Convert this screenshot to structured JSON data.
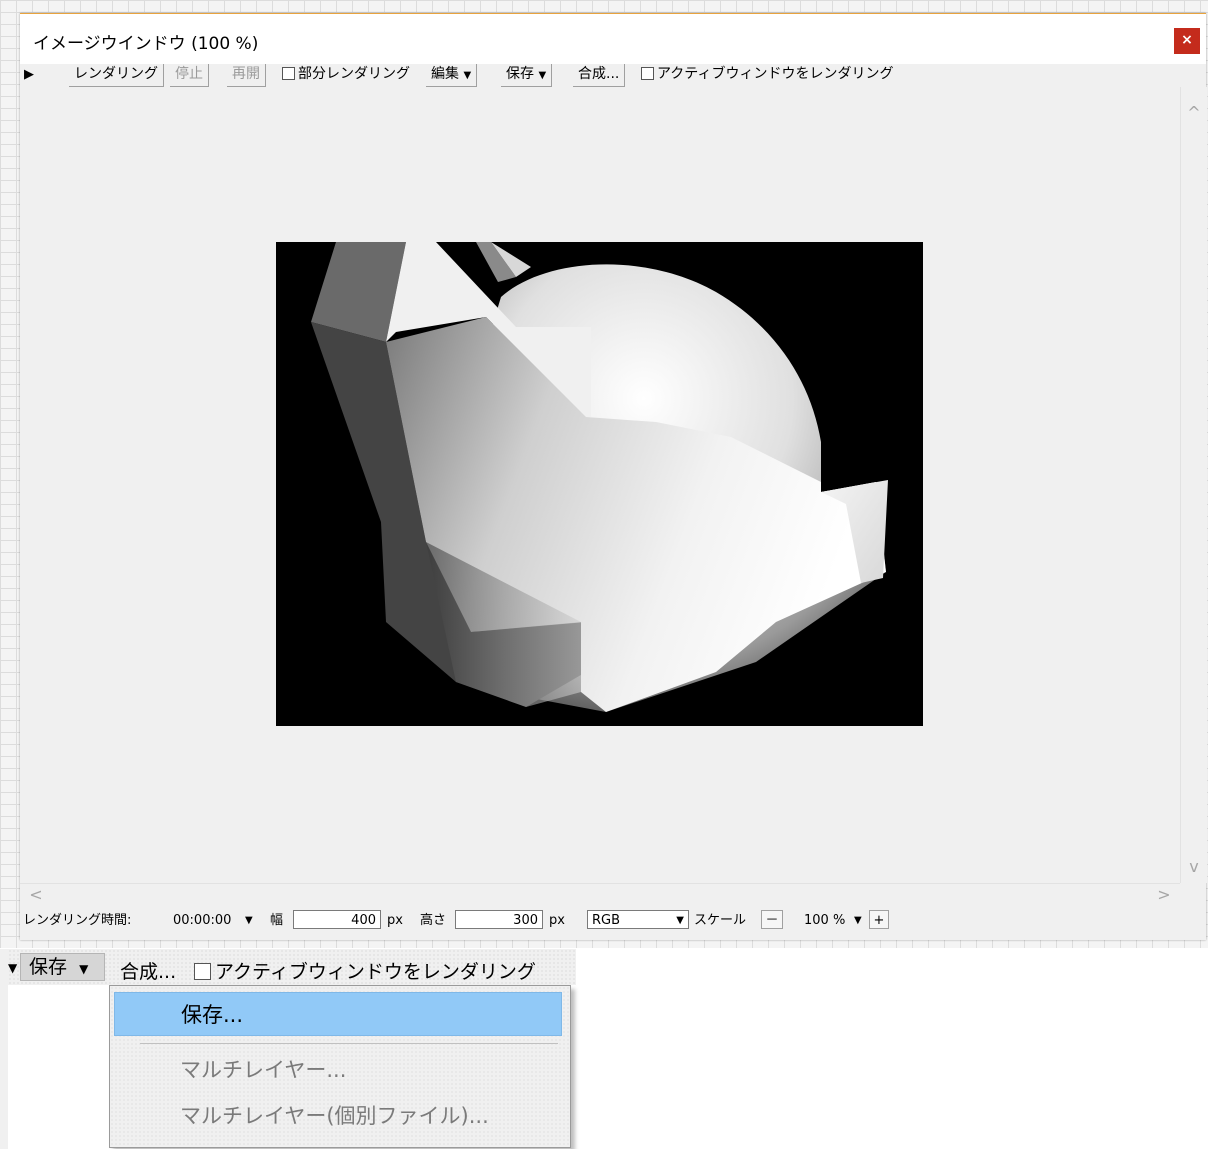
{
  "window": {
    "title": "イメージウインドウ (100 %)",
    "close_label": "×"
  },
  "toolbar": {
    "play_icon": "▶",
    "render": "レンダリング",
    "stop": "停止",
    "resume": "再開",
    "partial_render": "部分レンダリング",
    "edit": "編集",
    "save": "保存",
    "composite": "合成...",
    "active_window": "アクティブウィンドウをレンダリング",
    "dropdown_arrow": "▼"
  },
  "scrollbars": {
    "up": "^",
    "down": "v",
    "left": "<",
    "right": ">"
  },
  "status": {
    "render_time_label": "レンダリング時間:",
    "render_time_value": "00:00:00",
    "width_label": "幅",
    "width_value": "400",
    "width_unit": "px",
    "height_label": "高さ",
    "height_value": "300",
    "height_unit": "px",
    "color_mode": "RGB",
    "scale_label": "スケール",
    "scale_minus": "－",
    "scale_value": "100 %",
    "scale_plus": "+"
  },
  "zoomed_menu": {
    "save": "保存",
    "composite": "合成...",
    "active_window": "アクティブウィンドウをレンダリング",
    "items": [
      {
        "label": "保存...",
        "enabled": true,
        "highlighted": true
      },
      {
        "label": "マルチレイヤー...",
        "enabled": false
      },
      {
        "label": "マルチレイヤー(個別ファイル)...",
        "enabled": false
      }
    ]
  }
}
